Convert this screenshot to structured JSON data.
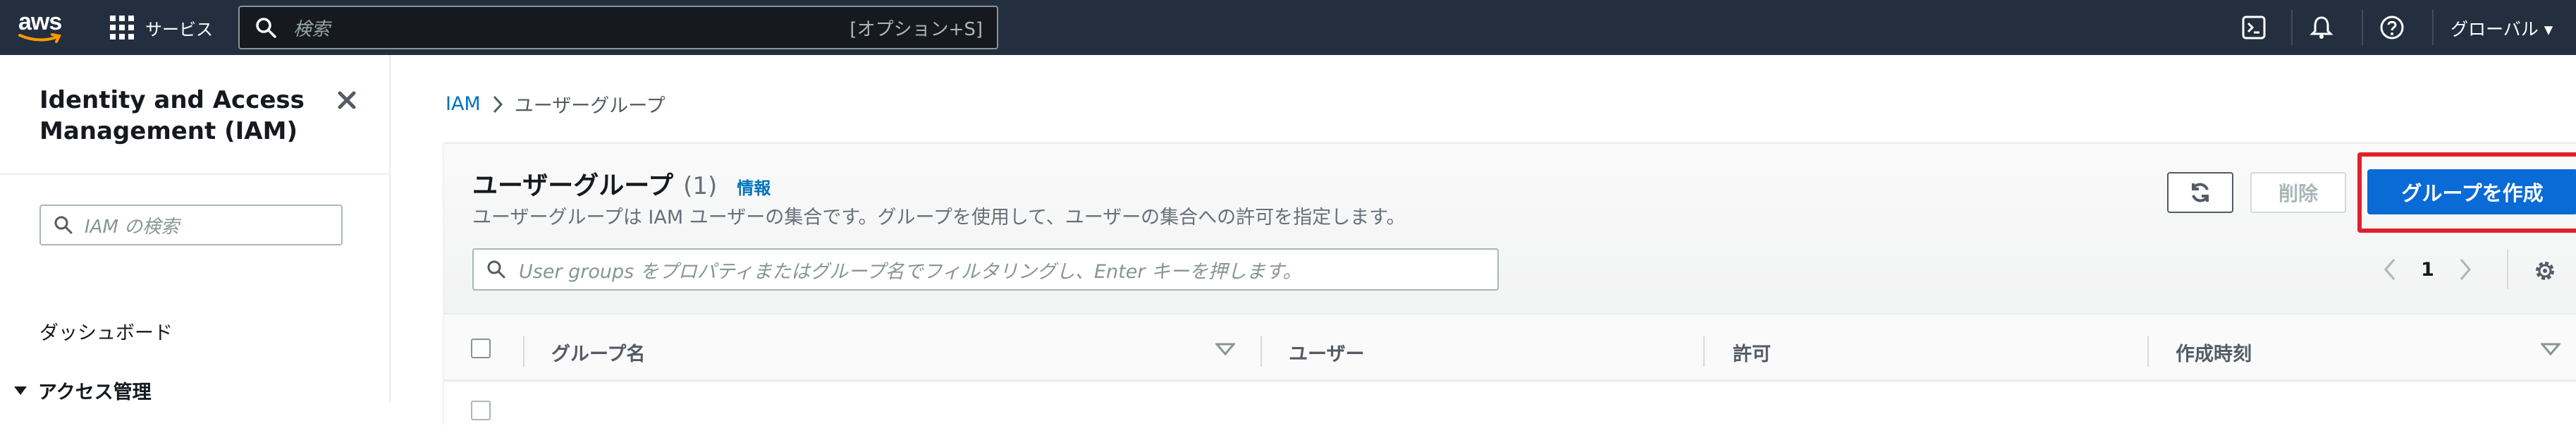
{
  "topnav": {
    "logo_text": "aws",
    "services_label": "サービス",
    "search_placeholder": "検索",
    "search_shortcut": "[オプション+S]",
    "region_label": "グローバル ▾"
  },
  "sidebar": {
    "title": "Identity and Access Management (IAM)",
    "search_placeholder": "IAM の検索",
    "items": [
      {
        "label": "ダッシュボード"
      }
    ],
    "section_label": "アクセス管理"
  },
  "breadcrumb": {
    "root": "IAM",
    "current": "ユーザーグループ"
  },
  "panel": {
    "title": "ユーザーグループ",
    "count": "(1)",
    "info_link": "情報",
    "description": "ユーザーグループは IAM ユーザーの集合です。グループを使用して、ユーザーの集合への許可を指定します。",
    "filter_placeholder": "User groups をプロパティまたはグループ名でフィルタリングし、Enter キーを押します。",
    "delete_label": "削除",
    "create_label": "グループを作成",
    "page_number": "1",
    "columns": [
      "グループ名",
      "ユーザー",
      "許可",
      "作成時刻"
    ]
  },
  "colors": {
    "nav_bg": "#232f3e",
    "primary": "#0a6ad6",
    "highlight": "#e0202a",
    "link": "#0073bb"
  }
}
